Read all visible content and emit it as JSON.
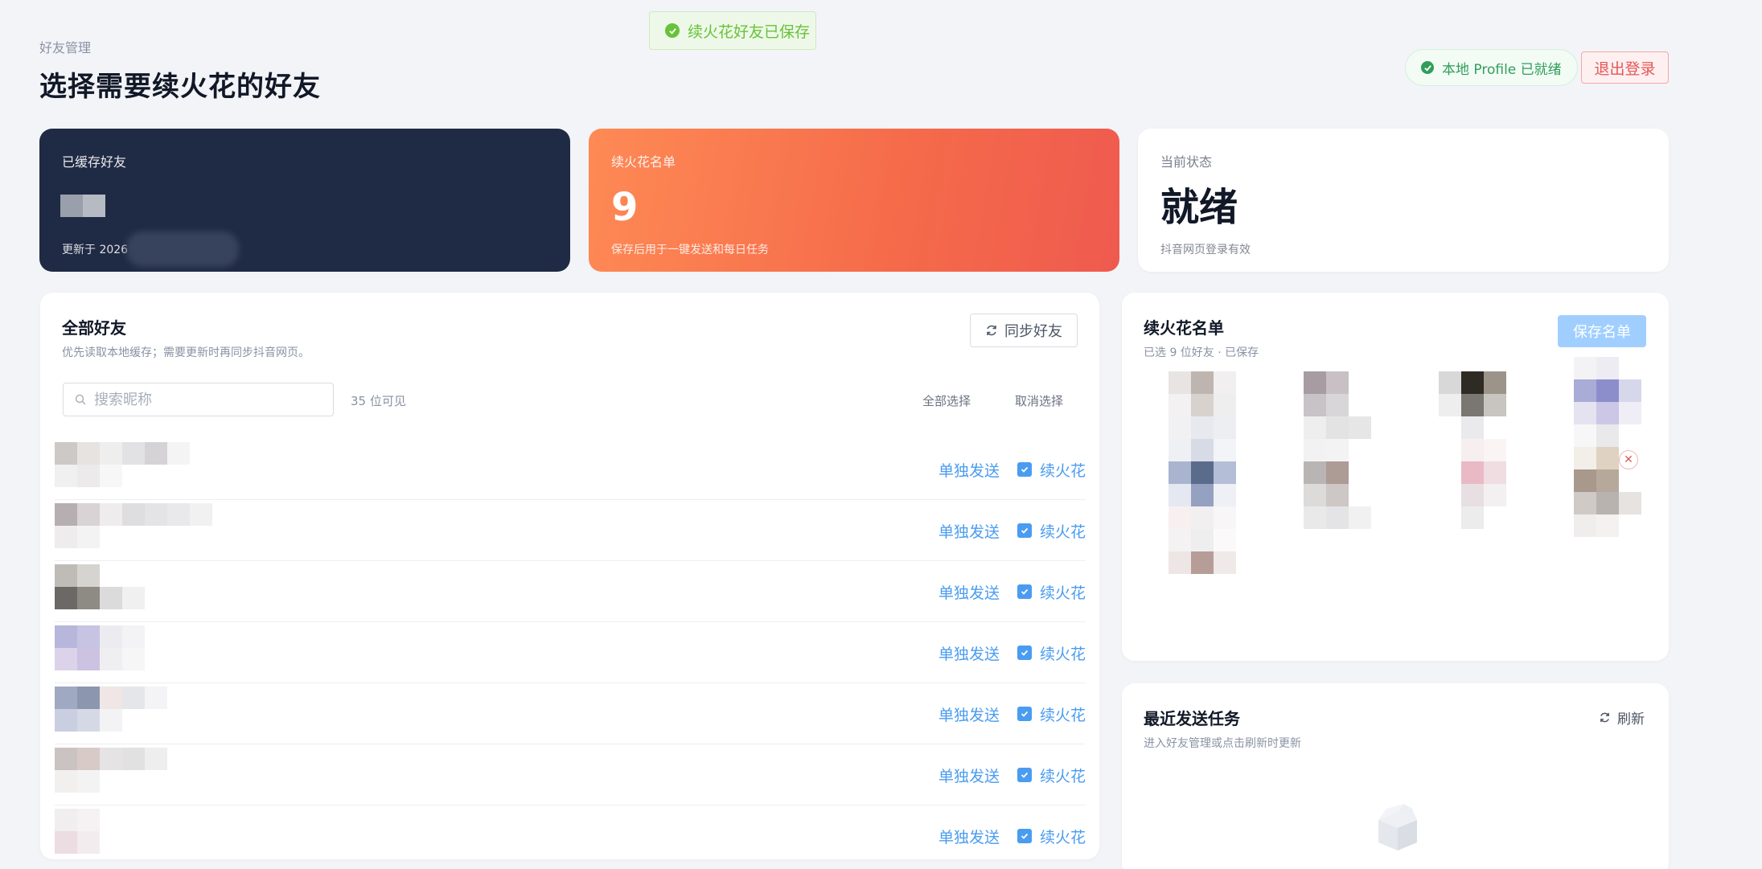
{
  "toast": {
    "message": "续火花好友已保存"
  },
  "header": {
    "breadcrumb": "好友管理",
    "title": "选择需要续火花的好友",
    "profile_status": "本地 Profile 已就绪",
    "logout_label": "退出登录"
  },
  "stats": {
    "cached": {
      "label": "已缓存好友",
      "sub": "更新于 2026"
    },
    "streak": {
      "label": "续火花名单",
      "value": "9",
      "sub": "保存后用于一键发送和每日任务"
    },
    "status": {
      "label": "当前状态",
      "value": "就绪",
      "sub": "抖音网页登录有效"
    }
  },
  "friends": {
    "title": "全部好友",
    "subtitle": "优先读取本地缓存；需要更新时再同步抖音网页。",
    "sync_label": "同步好友",
    "search_placeholder": "搜索昵称",
    "visible_count": "35 位可见",
    "select_all": "全部选择",
    "deselect_all": "取消选择",
    "rows": [
      {
        "send_label": "单独发送",
        "streak_label": "续火花",
        "checked": true
      },
      {
        "send_label": "单独发送",
        "streak_label": "续火花",
        "checked": true
      },
      {
        "send_label": "单独发送",
        "streak_label": "续火花",
        "checked": true
      },
      {
        "send_label": "单独发送",
        "streak_label": "续火花",
        "checked": true
      },
      {
        "send_label": "单独发送",
        "streak_label": "续火花",
        "checked": true
      },
      {
        "send_label": "单独发送",
        "streak_label": "续火花",
        "checked": true
      },
      {
        "send_label": "单独发送",
        "streak_label": "续火花",
        "checked": true
      }
    ]
  },
  "streak_list": {
    "title": "续火花名单",
    "subtitle": "已选 9 位好友 · 已保存",
    "save_label": "保存名单"
  },
  "tasks": {
    "title": "最近发送任务",
    "subtitle": "进入好友管理或点击刷新时更新",
    "refresh_label": "刷新"
  },
  "colors": {
    "accent": "#4a9cf0",
    "success": "#67c23a",
    "danger": "#e45656",
    "dark_card": "#1f2a44",
    "orange_card": "#f56a4a"
  }
}
